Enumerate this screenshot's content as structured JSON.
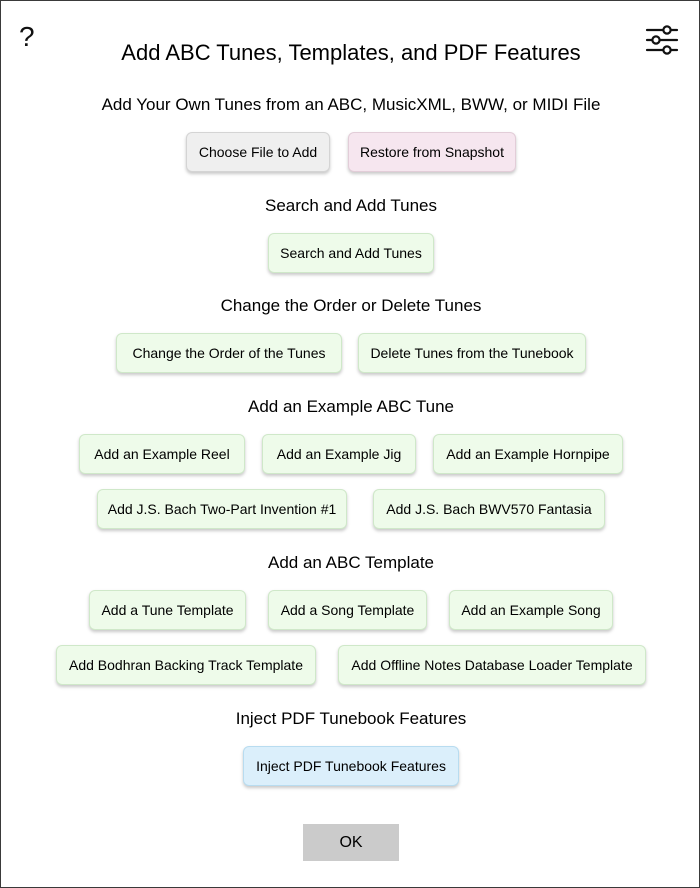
{
  "dialog": {
    "title": "Add ABC Tunes, Templates, and PDF Features",
    "help_glyph": "?",
    "help_icon": "question-mark-icon",
    "settings_icon": "sliders-icon"
  },
  "sections": {
    "files": {
      "heading": "Add Your Own Tunes from an ABC, MusicXML, BWW, or MIDI File",
      "choose_file": "Choose File to Add",
      "restore_snapshot": "Restore from Snapshot"
    },
    "search": {
      "heading": "Search and Add Tunes",
      "search_button": "Search and Add Tunes"
    },
    "order": {
      "heading": "Change the Order or Delete Tunes",
      "change_order": "Change the Order of the Tunes",
      "delete_tunes": "Delete Tunes from the Tunebook"
    },
    "examples": {
      "heading": "Add an Example ABC Tune",
      "reel": "Add an Example Reel",
      "jig": "Add an Example Jig",
      "hornpipe": "Add an Example Hornpipe",
      "bach_invention": "Add J.S. Bach Two-Part Invention #1",
      "bach_fantasia": "Add J.S. Bach BWV570 Fantasia"
    },
    "templates": {
      "heading": "Add an ABC Template",
      "tune_template": "Add a Tune Template",
      "song_template": "Add a Song Template",
      "example_song": "Add an Example Song",
      "bodhran": "Add Bodhran Backing Track Template",
      "offline_notes": "Add Offline Notes Database Loader Template"
    },
    "pdf": {
      "heading": "Inject PDF Tunebook Features",
      "inject_button": "Inject PDF Tunebook Features"
    }
  },
  "footer": {
    "ok_label": "OK"
  },
  "colors": {
    "green_button": "#eefbea",
    "grey_button": "#efefef",
    "pink_button": "#f6e6ef",
    "blue_button": "#dbeffb",
    "ok_button": "#cbcbcb"
  }
}
